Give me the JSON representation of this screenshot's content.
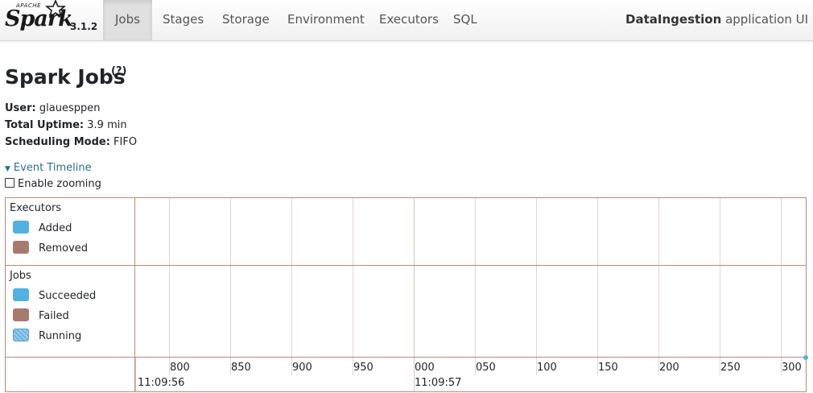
{
  "brand": {
    "apache": "APACHE",
    "spark": "Spark",
    "version": "3.1.2"
  },
  "nav": {
    "tabs": [
      "Jobs",
      "Stages",
      "Storage",
      "Environment",
      "Executors",
      "SQL"
    ],
    "active": "Jobs",
    "app_name": "DataIngestion",
    "app_suffix": "application UI"
  },
  "page": {
    "title": "Spark Jobs",
    "help": "(?)",
    "user_label": "User:",
    "user": "glauesppen",
    "uptime_label": "Total Uptime:",
    "uptime": "3.9 min",
    "mode_label": "Scheduling Mode:",
    "mode": "FIFO"
  },
  "timeline": {
    "toggle": "Event Timeline",
    "zoom_label": "Enable zooming",
    "zoom_enabled": false,
    "executors_title": "Executors",
    "executors_legend": [
      "Added",
      "Removed"
    ],
    "jobs_title": "Jobs",
    "jobs_legend": [
      "Succeeded",
      "Failed",
      "Running"
    ],
    "ticks": [
      "800",
      "850",
      "900",
      "950",
      "000",
      "050",
      "100",
      "150",
      "200",
      "250",
      "300"
    ],
    "major_labels": [
      "11:09:56",
      "11:09:57"
    ],
    "colors": {
      "added": "#52b1e0",
      "removed": "#a67b6f",
      "succeeded": "#52b1e0",
      "failed": "#a67b6f",
      "running": "#6ab5e0"
    }
  }
}
